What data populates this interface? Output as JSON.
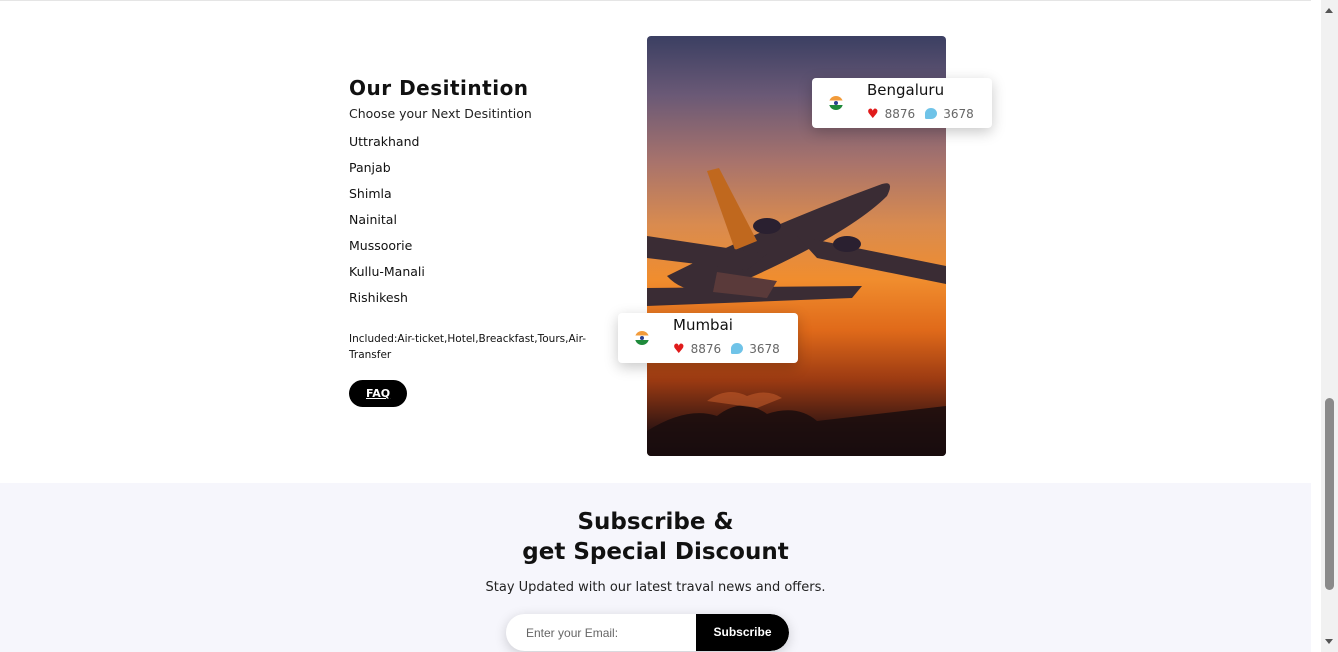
{
  "destinations": {
    "title": "Our Desitintion",
    "subtitle": "Choose your Next Desitintion",
    "items": [
      "Uttrakhand",
      "Panjab",
      "Shimla",
      "Nainital",
      "Mussoorie",
      "Kullu-Manali",
      "Rishikesh"
    ],
    "included": "Included:Air-ticket,Hotel,Breackfast,Tours,Air-Transfer",
    "faq_label": "FAQ"
  },
  "cards": [
    {
      "city": "Bengaluru",
      "likes": "8876",
      "comments": "3678",
      "flag_icon": "india-flag-icon"
    },
    {
      "city": "Mumbai",
      "likes": "8876",
      "comments": "3678",
      "flag_icon": "india-flag-icon"
    }
  ],
  "subscribe": {
    "title_line1": "Subscribe &",
    "title_line2": "get Special Discount",
    "tagline": "Stay Updated with our latest traval news and offers.",
    "email_placeholder": "Enter your Email:",
    "button_label": "Subscribe"
  },
  "colors": {
    "heart": "#e01b1b",
    "comment": "#6fc3e8",
    "subscribe_bg": "#f6f6fc",
    "button_bg": "#000000"
  }
}
